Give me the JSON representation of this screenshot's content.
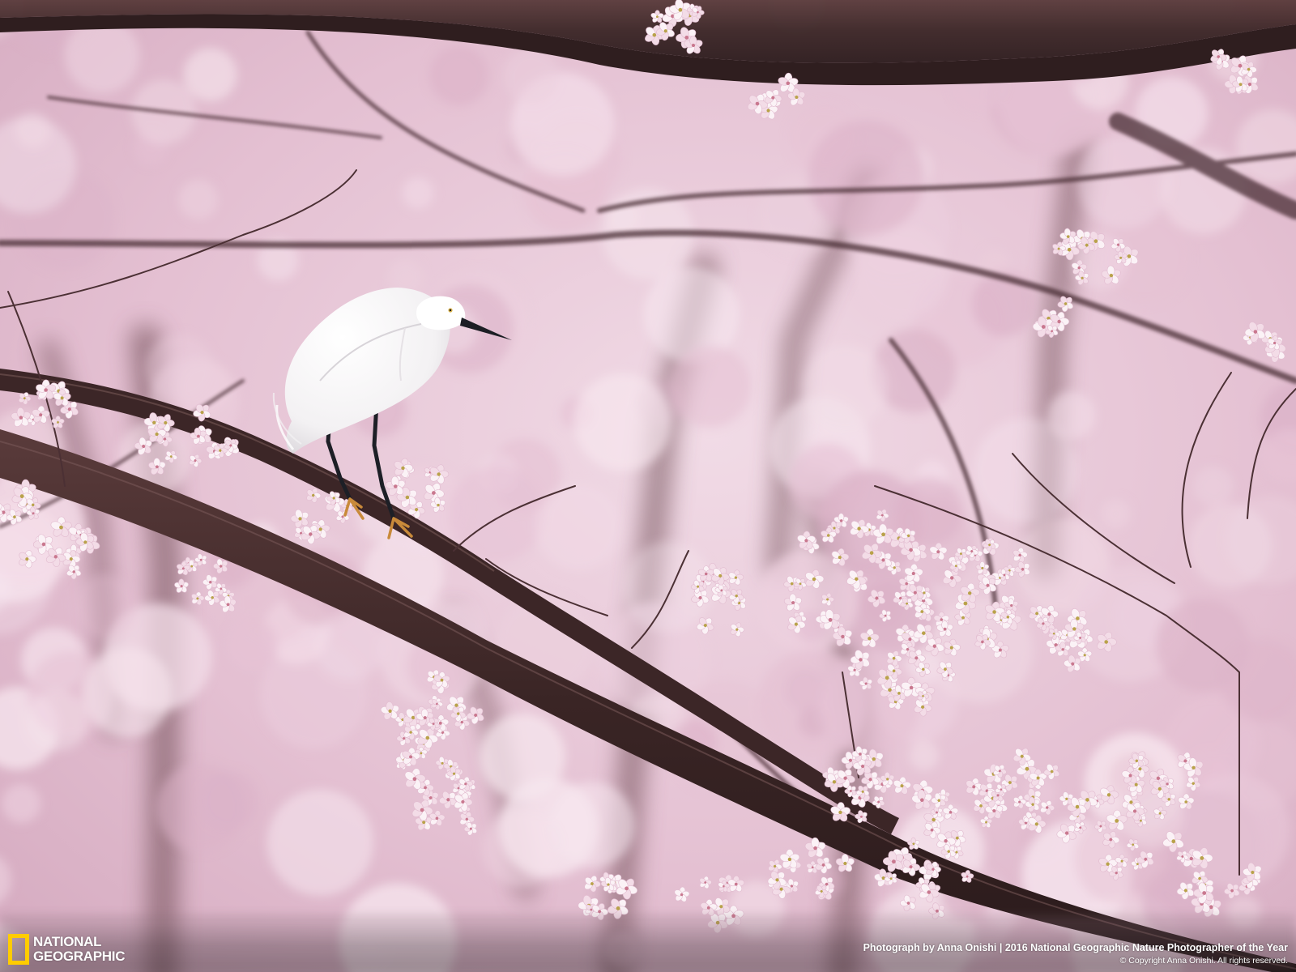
{
  "photo": {
    "subject": "egret-on-cherry-blossom-branch"
  },
  "logo": {
    "line1": "NATIONAL",
    "line2": "GEOGRAPHIC",
    "frame_color": "#ffcc00"
  },
  "caption": {
    "credit": "Photograph by Anna Onishi | 2016 National Geographic Nature Photographer of the Year",
    "copyright": "© Copyright Anna Onishi. All rights reserved."
  },
  "colors": {
    "blossom_pink": "#e9c7d8",
    "blossom_white": "#fbf2f6",
    "bark_dark": "#3a2424",
    "egret_white": "#fbfbfb"
  }
}
